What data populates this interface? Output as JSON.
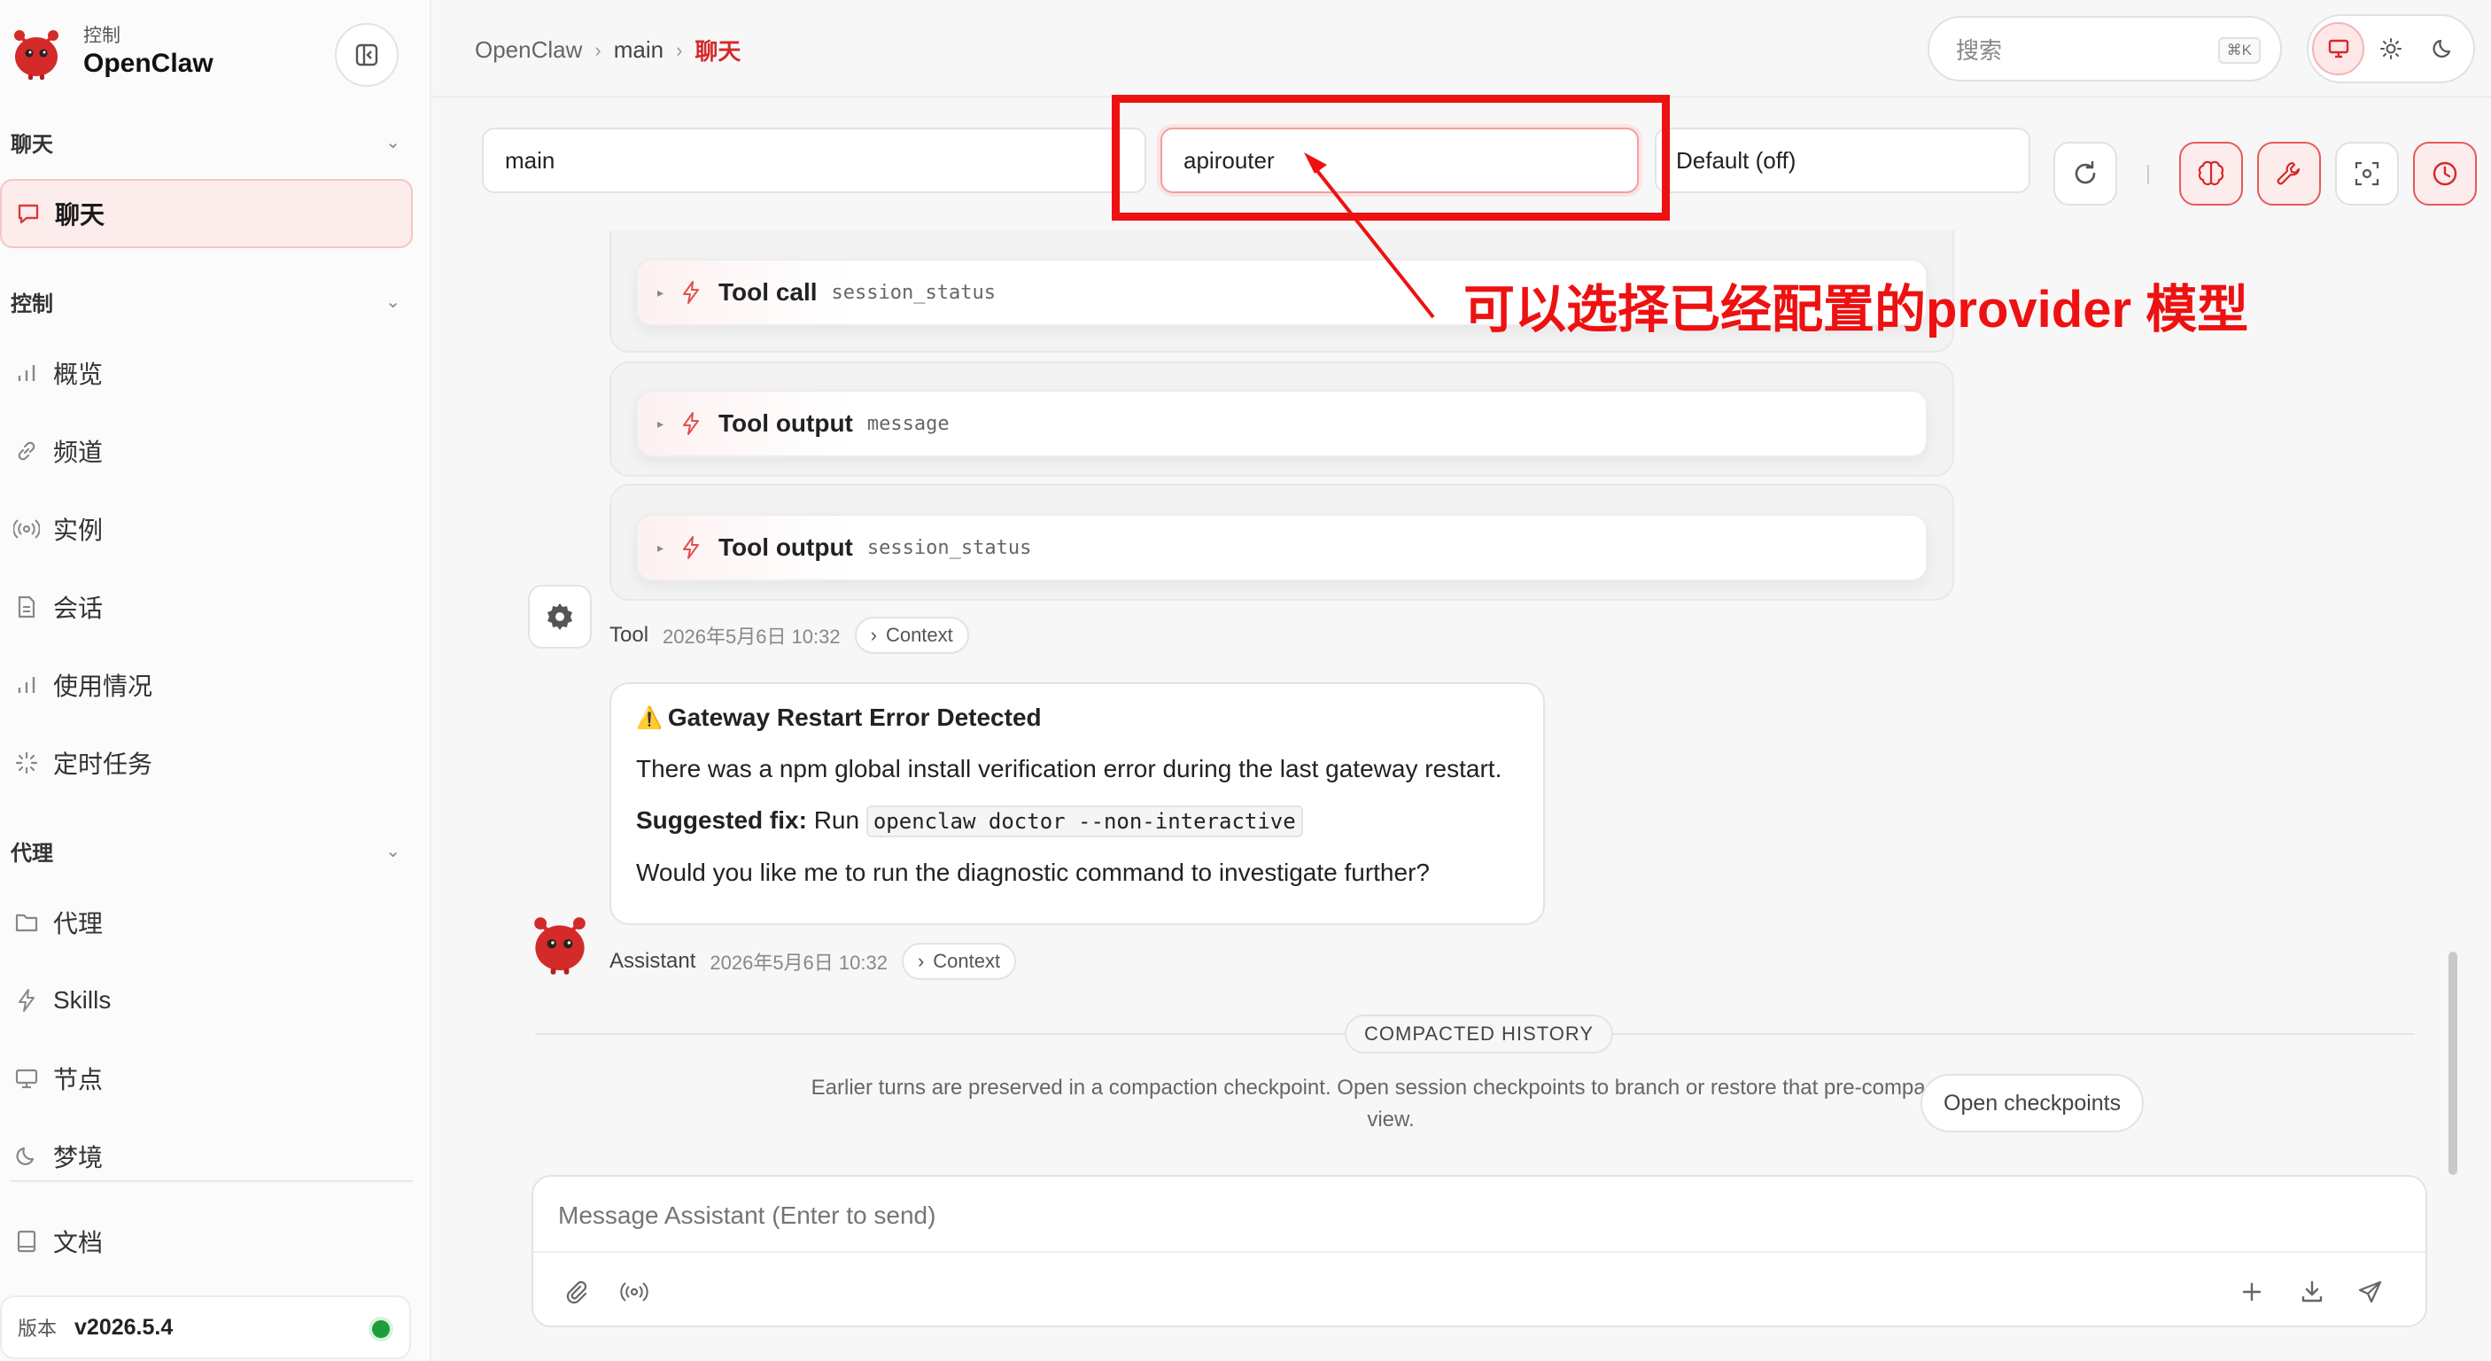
{
  "app": {
    "sub_label": "控制",
    "name": "OpenClaw"
  },
  "sidebar": {
    "sections": [
      {
        "label": "聊天"
      },
      {
        "label": "控制"
      },
      {
        "label": "代理"
      }
    ],
    "items": [
      {
        "label": "聊天",
        "icon": "chat-bubble-icon",
        "active": true
      },
      {
        "label": "概览",
        "icon": "bar-chart-icon"
      },
      {
        "label": "频道",
        "icon": "link-icon"
      },
      {
        "label": "实例",
        "icon": "broadcast-icon"
      },
      {
        "label": "会话",
        "icon": "document-icon"
      },
      {
        "label": "使用情况",
        "icon": "bar-chart-icon"
      },
      {
        "label": "定时任务",
        "icon": "loader-icon"
      },
      {
        "label": "代理",
        "icon": "folder-icon"
      },
      {
        "label": "Skills",
        "icon": "bolt-icon"
      },
      {
        "label": "节点",
        "icon": "monitor-icon"
      },
      {
        "label": "梦境",
        "icon": "moon-icon"
      },
      {
        "label": "文档",
        "icon": "book-icon"
      }
    ],
    "version_label": "版本",
    "version_value": "v2026.5.4",
    "status_color": "#1f9d3c"
  },
  "header": {
    "breadcrumb": [
      "OpenClaw",
      "main",
      "聊天"
    ],
    "search_placeholder": "搜索",
    "search_shortcut": "⌘K"
  },
  "toolbar": {
    "session_value": "main",
    "provider_value": "apirouter",
    "thinking_value": "Default (off)"
  },
  "chat": {
    "tool_items": [
      {
        "title": "Tool call",
        "arg": "session_status"
      },
      {
        "title": "Tool output",
        "arg": "message"
      },
      {
        "title": "Tool output",
        "arg": "session_status"
      }
    ],
    "tool_meta": {
      "who": "Tool",
      "time": "2026年5月6日 10:32",
      "context": "Context"
    },
    "assistant_message": {
      "heading_icon": "⚠️",
      "heading": "Gateway Restart Error Detected",
      "line1": "There was a npm global install verification error during the last gateway restart.",
      "fix_label": "Suggested fix:",
      "fix_run": "Run",
      "fix_command": "openclaw doctor --non-interactive",
      "question": "Would you like me to run the diagnostic command to investigate further?"
    },
    "assistant_meta": {
      "who": "Assistant",
      "time": "2026年5月6日 10:32",
      "context": "Context"
    },
    "compacted": {
      "pill": "COMPACTED HISTORY",
      "text": "Earlier turns are preserved in a compaction checkpoint. Open session checkpoints to branch or restore that pre-compaction view.",
      "button": "Open checkpoints"
    }
  },
  "composer": {
    "placeholder": "Message Assistant (Enter to send)"
  },
  "annotation": {
    "text": "可以选择已经配置的provider 模型",
    "color": "#ee1111"
  },
  "colors": {
    "accent": "#d62828",
    "active_bg": "#fdecec"
  }
}
